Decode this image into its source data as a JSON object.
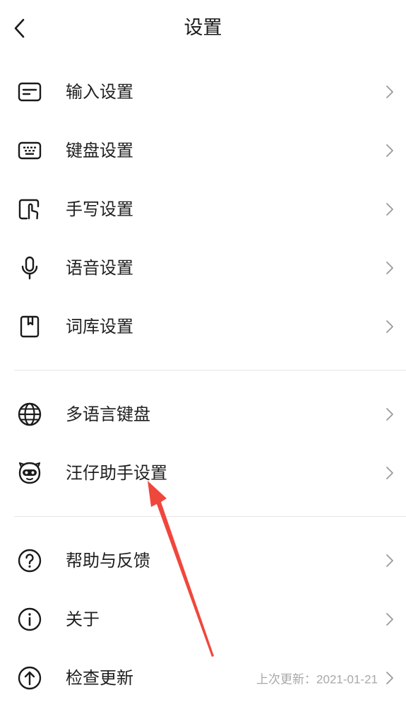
{
  "header": {
    "title": "设置",
    "back_icon": "chevron-left-icon"
  },
  "groups": [
    {
      "items": [
        {
          "id": "input",
          "label": "输入设置",
          "icon": "input-settings-icon"
        },
        {
          "id": "keyboard",
          "label": "键盘设置",
          "icon": "keyboard-icon"
        },
        {
          "id": "handwriting",
          "label": "手写设置",
          "icon": "handwriting-icon"
        },
        {
          "id": "voice",
          "label": "语音设置",
          "icon": "microphone-icon"
        },
        {
          "id": "lexicon",
          "label": "词库设置",
          "icon": "lexicon-book-icon"
        }
      ]
    },
    {
      "items": [
        {
          "id": "multilang",
          "label": "多语言键盘",
          "icon": "globe-icon"
        },
        {
          "id": "assistant",
          "label": "汪仔助手设置",
          "icon": "assistant-mascot-icon"
        }
      ]
    },
    {
      "items": [
        {
          "id": "help",
          "label": "帮助与反馈",
          "icon": "help-circle-icon"
        },
        {
          "id": "about",
          "label": "关于",
          "icon": "info-circle-icon"
        },
        {
          "id": "update",
          "label": "检查更新",
          "icon": "upload-circle-icon",
          "extra": "上次更新：2021-01-21"
        }
      ]
    }
  ],
  "colors": {
    "text": "#1f1f1f",
    "secondary_text": "#a8a8a8",
    "chevron": "#9a9a9a",
    "divider": "#e6e6e6",
    "annotation_arrow": "#f0473c"
  }
}
